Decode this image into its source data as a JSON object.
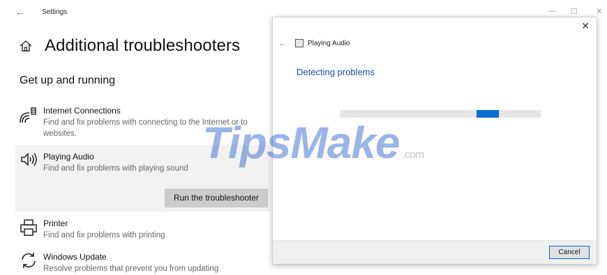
{
  "window": {
    "title": "Settings",
    "back_glyph": "←",
    "minimize_glyph": "—",
    "maximize_glyph": "☐",
    "close_glyph": "✕"
  },
  "page": {
    "title": "Additional troubleshooters",
    "section": "Get up and running"
  },
  "troubleshooters": [
    {
      "icon": "wifi-icon",
      "name": "Internet Connections",
      "desc": "Find and fix problems with connecting to the Internet or to websites."
    },
    {
      "icon": "speaker-icon",
      "name": "Playing Audio",
      "desc": "Find and fix problems with playing sound",
      "selected": true
    },
    {
      "icon": "printer-icon",
      "name": "Printer",
      "desc": "Find and fix problems with printing"
    },
    {
      "icon": "refresh-icon",
      "name": "Windows Update",
      "desc": "Resolve problems that prevent you from updating"
    }
  ],
  "run_button": "Run the troubleshooter",
  "dialog": {
    "close_glyph": "✕",
    "back_glyph": "←",
    "app_title": "Playing Audio",
    "heading": "Detecting problems",
    "cancel": "Cancel",
    "progress": {
      "indeterminate": true,
      "position_fraction": 0.68,
      "width_fraction": 0.11
    }
  },
  "watermark": {
    "main": "TipsMake",
    "suffix": ".com"
  },
  "colors": {
    "accent": "#0b6fd0",
    "heading_blue": "#1a4fa0",
    "selected_bg": "#f2f2f2",
    "button_gray": "#cccccc"
  }
}
